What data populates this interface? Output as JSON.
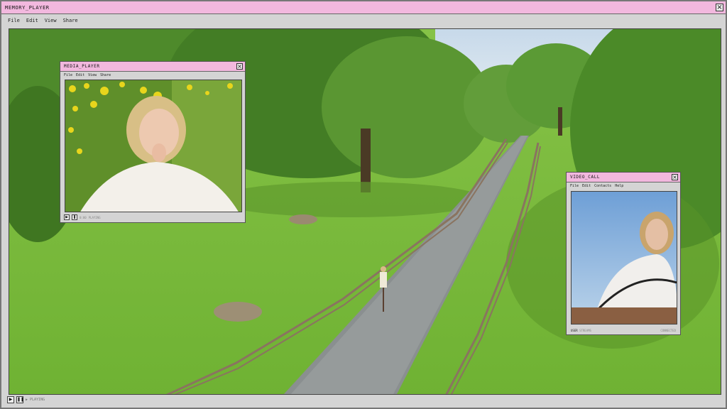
{
  "main_window": {
    "title": "MEMORY_PLAYER",
    "menu": [
      "File",
      "Edit",
      "View",
      "Share"
    ],
    "status": "▶ PLAYING"
  },
  "media_player": {
    "title": "MEDIA_PLAYER",
    "menu": [
      "File",
      "Edit",
      "View",
      "Share"
    ],
    "time": "0:00",
    "status": "PLAYING"
  },
  "video_call": {
    "title": "VIDEO_CALL",
    "menu": [
      "File",
      "Edit",
      "Contacts",
      "Help"
    ],
    "user_label": "USER",
    "user_value": "STREAMS",
    "status": "CONNECTED"
  },
  "icons": {
    "close": "close-icon",
    "play": "play-icon",
    "pause": "pause-icon"
  },
  "colors": {
    "titlebar": "#f2b8de",
    "chrome": "#d4d4d4"
  }
}
